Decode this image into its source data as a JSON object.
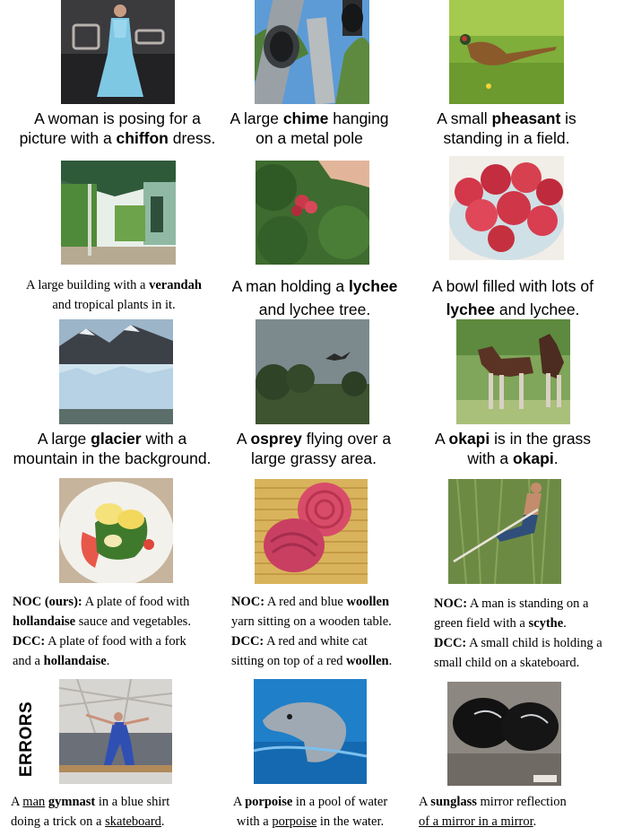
{
  "row1": {
    "c1": {
      "l1a": "A woman is posing for a",
      "l2a": "picture with a ",
      "l2b": "chiffon",
      "l2c": " dress."
    },
    "c2": {
      "l1a": "A large ",
      "l1b": "chime",
      "l1c": " hanging",
      "l2a": "on a metal pole"
    },
    "c3": {
      "l1a": "A small ",
      "l1b": "pheasant",
      "l1c": " is",
      "l2a": "standing in a field."
    }
  },
  "row2": {
    "c1": {
      "l1a": "A large building with a ",
      "l1b": "verandah",
      "l2a": "and tropical plants in it."
    },
    "c2": {
      "l1a": "A man holding a ",
      "l1b": "lychee",
      "l2a": "and lychee tree."
    },
    "c3": {
      "l1a": "A bowl filled with lots of",
      "l2a": "lychee",
      "l2b": " and lychee."
    }
  },
  "row3": {
    "c1": {
      "l1a": "A large ",
      "l1b": "glacier",
      "l1c": " with a",
      "l2a": "mountain in the background."
    },
    "c2": {
      "l1a": "A ",
      "l1b": "osprey",
      "l1c": " flying over a",
      "l2a": "large grassy area."
    },
    "c3": {
      "l1a": "A ",
      "l1b": "okapi",
      "l1c": " is in the grass",
      "l2a": "with a ",
      "l2b": "okapi",
      "l2c": "."
    }
  },
  "row4": {
    "c1": {
      "noc_label": "NOC (ours)",
      "noc_colon": ":",
      "noc_l1": " A plate of food with",
      "noc_l2a": "hollandaise",
      "noc_l2b": " sauce and vegetables.",
      "dcc_label": "DCC:",
      "dcc_l1": " A plate of food with a fork",
      "dcc_l2a": "and a ",
      "dcc_l2b": "hollandaise",
      "dcc_l2c": "."
    },
    "c2": {
      "noc_label": "NOC:",
      "noc_l1a": " A red and blue ",
      "noc_l1b": "woollen",
      "noc_l2": "yarn sitting on a wooden table.",
      "dcc_label": "DCC:",
      "dcc_l1": " A red and white cat",
      "dcc_l2a": "sitting on top of a red ",
      "dcc_l2b": "woollen",
      "dcc_l2c": "."
    },
    "c3": {
      "noc_label": "NOC:",
      "noc_l1": " A man is standing on a",
      "noc_l2a": "green field with a ",
      "noc_l2b": "scythe",
      "noc_l2c": ".",
      "dcc_label": "DCC:",
      "dcc_l1": " A small child is holding a",
      "dcc_l2": "small child on a skateboard."
    }
  },
  "errors": {
    "label": "ERRORS",
    "c1": {
      "l1a": "A ",
      "l1b": "man",
      "l1c": " ",
      "l1d": "gymnast",
      "l1e": " in a blue shirt",
      "l2a": "doing a trick on a ",
      "l2b": "skateboard",
      "l2c": "."
    },
    "c2": {
      "l1a": "A ",
      "l1b": "porpoise",
      "l1c": " in a pool of water",
      "l2a": "with a ",
      "l2b": "porpoise",
      "l2c": " in the water."
    },
    "c3": {
      "l1a": "A ",
      "l1b": "sunglass",
      "l1c": " mirror reflection",
      "l2a": "of a mirror in a mirror",
      "l2b": "."
    }
  }
}
